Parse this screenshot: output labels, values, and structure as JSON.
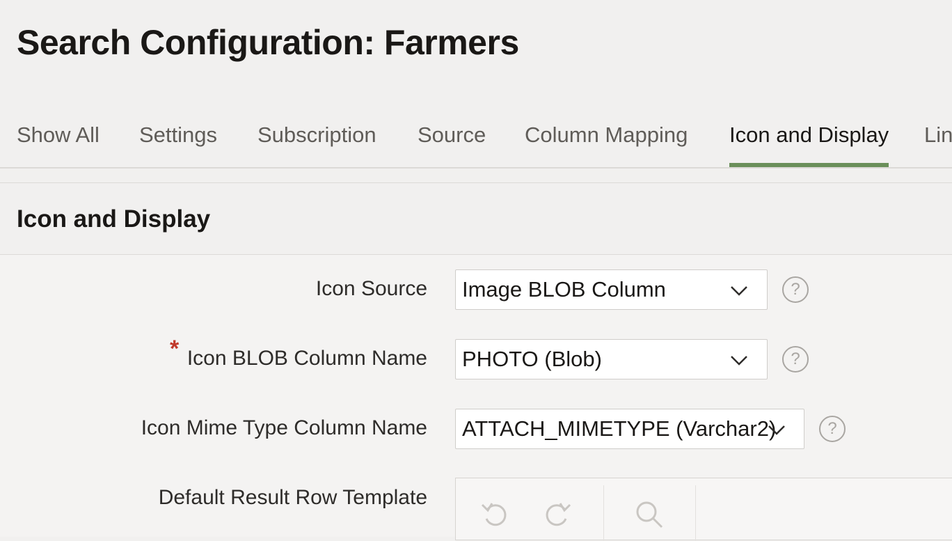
{
  "page": {
    "title": "Search Configuration: Farmers"
  },
  "tabs": [
    {
      "label": "Show All"
    },
    {
      "label": "Settings"
    },
    {
      "label": "Subscription"
    },
    {
      "label": "Source"
    },
    {
      "label": "Column Mapping"
    },
    {
      "label": "Icon and Display",
      "active": true
    },
    {
      "label": "Lin"
    }
  ],
  "region": {
    "title": "Icon and Display"
  },
  "fields": {
    "icon_source": {
      "label": "Icon Source",
      "value": "Image BLOB Column",
      "help": "?"
    },
    "icon_blob_column": {
      "label": "Icon BLOB Column Name",
      "required_mark": "*",
      "value": "PHOTO (Blob)",
      "help": "?"
    },
    "icon_mime_column": {
      "label": "Icon Mime Type Column Name",
      "value": "ATTACH_MIMETYPE (Varchar2)",
      "help": "?"
    },
    "default_row_template": {
      "label": "Default Result Row Template"
    }
  },
  "editor_toolbar": {
    "icons": [
      "undo-icon",
      "redo-icon",
      "search-icon"
    ]
  },
  "colors": {
    "active_tab_underline": "#6a8f5a",
    "required": "#c0392b",
    "background": "#f1f0ef"
  }
}
